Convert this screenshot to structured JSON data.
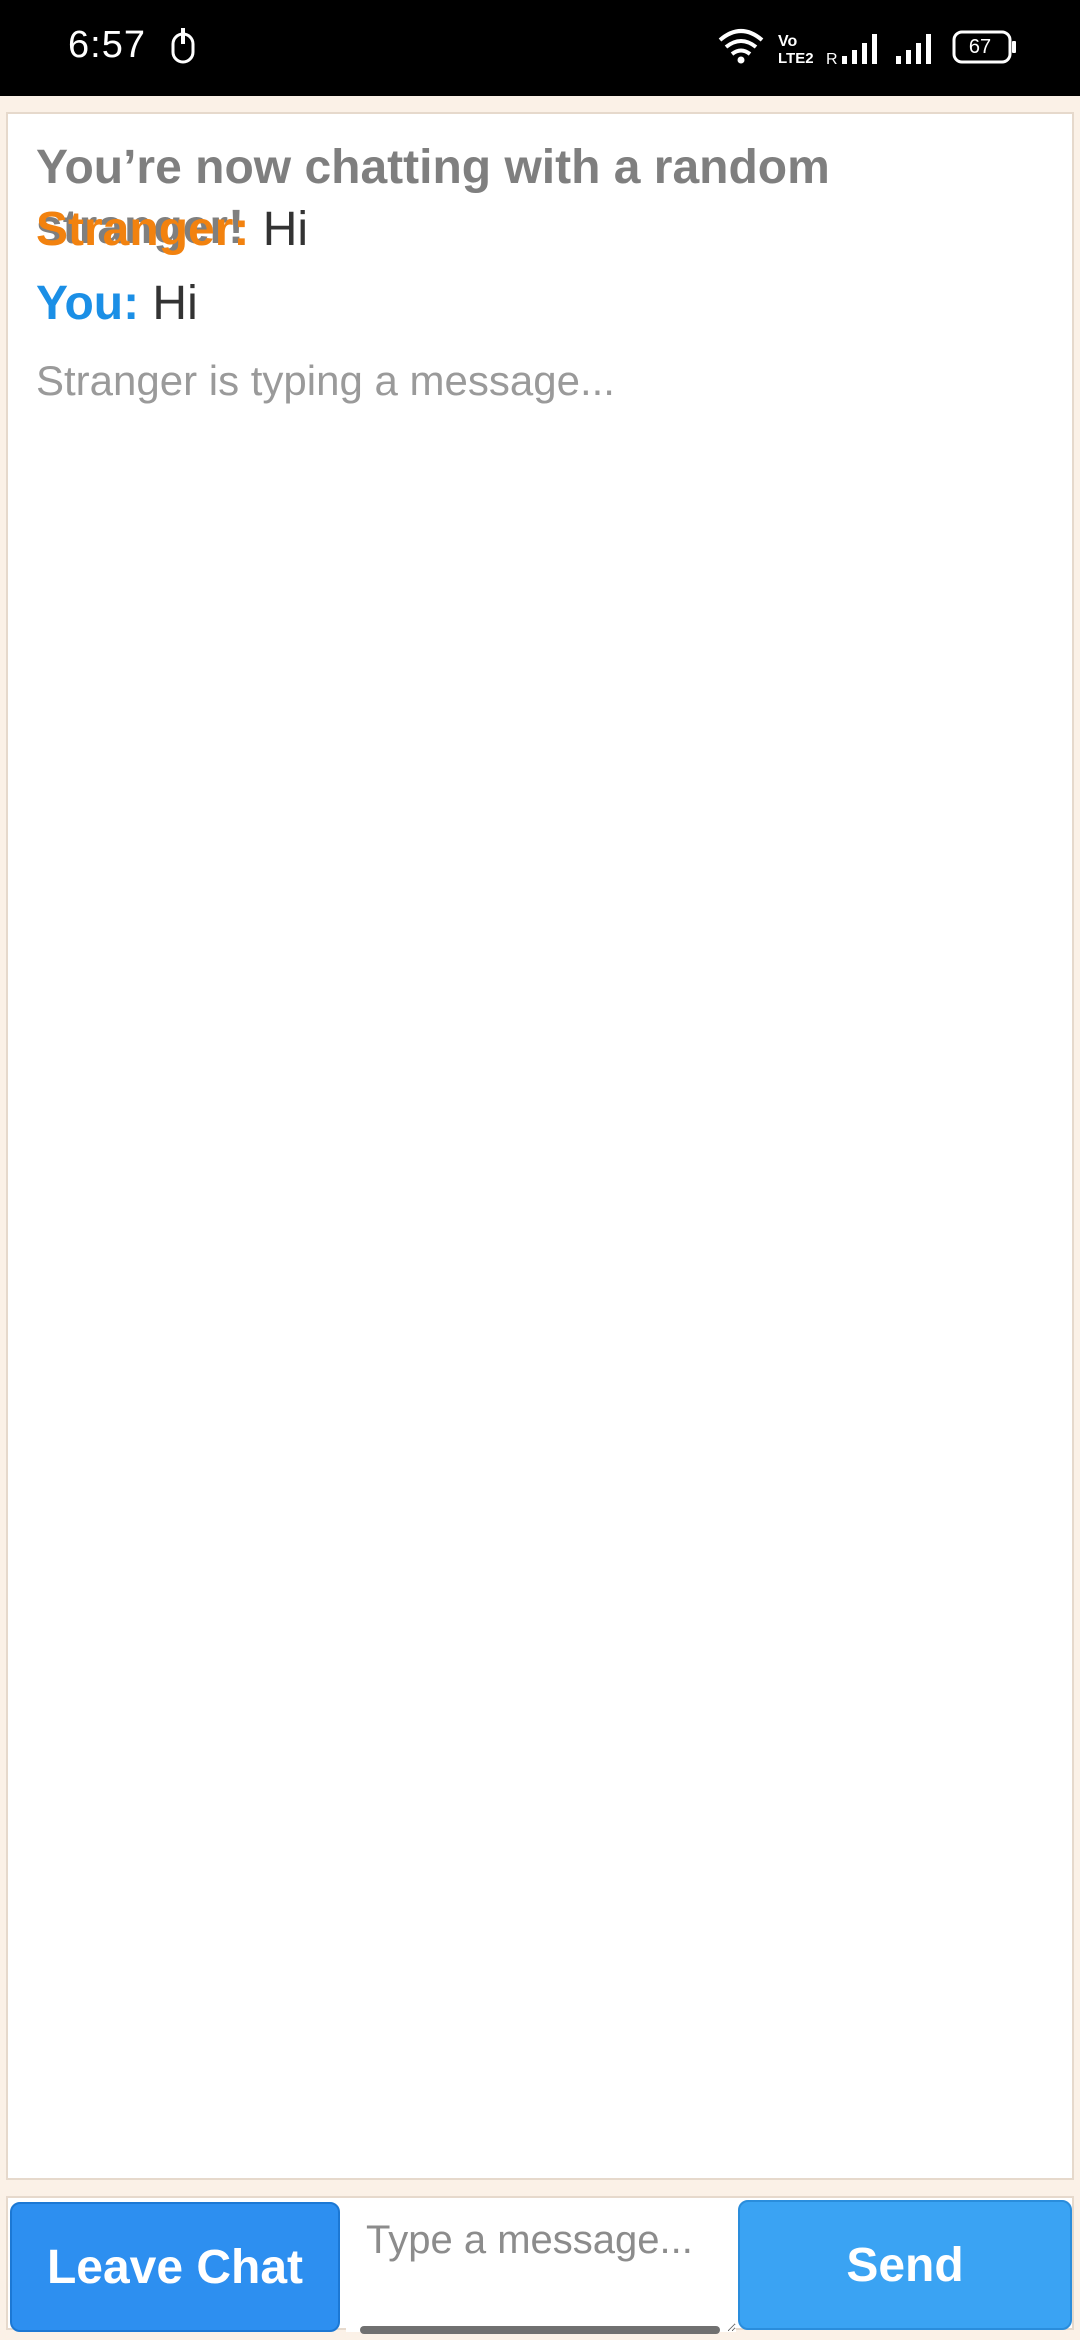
{
  "status_bar": {
    "time": "6:57",
    "battery": "67",
    "icons": [
      "screen-record-icon",
      "wifi-icon",
      "volte-lte2-icon",
      "signal-roaming-icon",
      "signal-icon",
      "battery-icon"
    ]
  },
  "chat": {
    "intro": "You’re now chatting with a random stranger!",
    "messages": [
      {
        "sender": "Stranger:",
        "text": "Hi"
      },
      {
        "sender": "You:",
        "text": "Hi"
      }
    ],
    "typing_status": "Stranger is typing a message..."
  },
  "controls": {
    "leave_label": "Leave Chat",
    "input_placeholder": "Type a message...",
    "input_value": "",
    "send_label": "Send"
  },
  "colors": {
    "stranger": "#f2820f",
    "you": "#1b8fe6",
    "button": "#2d8ff0"
  }
}
